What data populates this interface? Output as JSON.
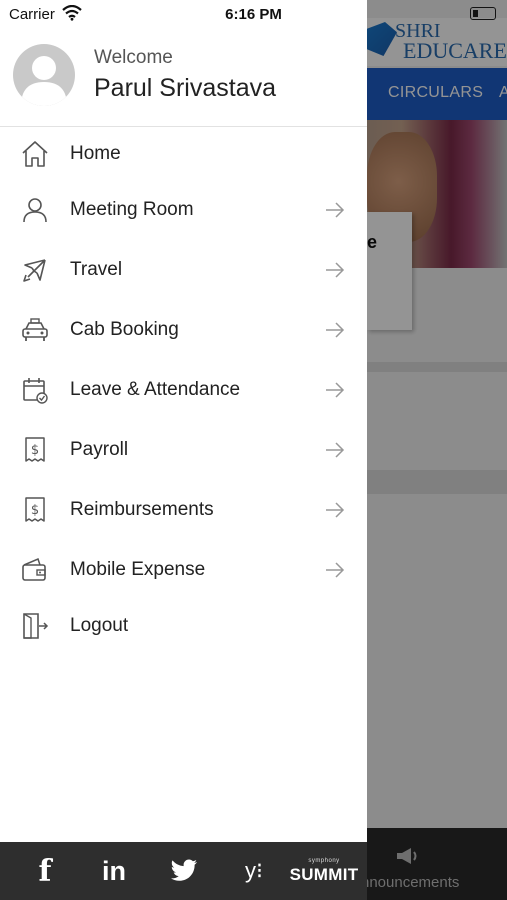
{
  "status_bar": {
    "carrier": "Carrier",
    "time": "6:16 PM"
  },
  "background_app": {
    "logo_line1": "SHRI",
    "logo_line2": "EDUCARE",
    "tabs": [
      "CIRCULARS",
      "A"
    ],
    "card_text": "e",
    "bottom_tab_label": "nnouncements"
  },
  "profile": {
    "welcome": "Welcome",
    "name": "Parul Srivastava"
  },
  "menu": {
    "items": [
      {
        "label": "Home",
        "icon": "home-icon",
        "arrow": false
      },
      {
        "label": "Meeting Room",
        "icon": "person-icon",
        "arrow": true
      },
      {
        "label": "Travel",
        "icon": "airplane-icon",
        "arrow": true
      },
      {
        "label": "Cab Booking",
        "icon": "car-icon",
        "arrow": true
      },
      {
        "label": "Leave & Attendance",
        "icon": "calendar-icon",
        "arrow": true
      },
      {
        "label": "Payroll",
        "icon": "receipt-dollar-icon",
        "arrow": true
      },
      {
        "label": "Reimbursements",
        "icon": "receipt-dollar-icon",
        "arrow": true
      },
      {
        "label": "Mobile Expense",
        "icon": "wallet-icon",
        "arrow": true
      },
      {
        "label": "Logout",
        "icon": "logout-door-icon",
        "arrow": false
      }
    ]
  },
  "social": {
    "facebook": "f",
    "linkedin": "in",
    "yammer": "y⁝",
    "summit_small": "symphony",
    "summit_big": "SUMMIT"
  },
  "colors": {
    "tab_bar_blue": "#1e5ec8",
    "bottom_bar": "#2e2e2e",
    "icon_gray": "#555555"
  }
}
